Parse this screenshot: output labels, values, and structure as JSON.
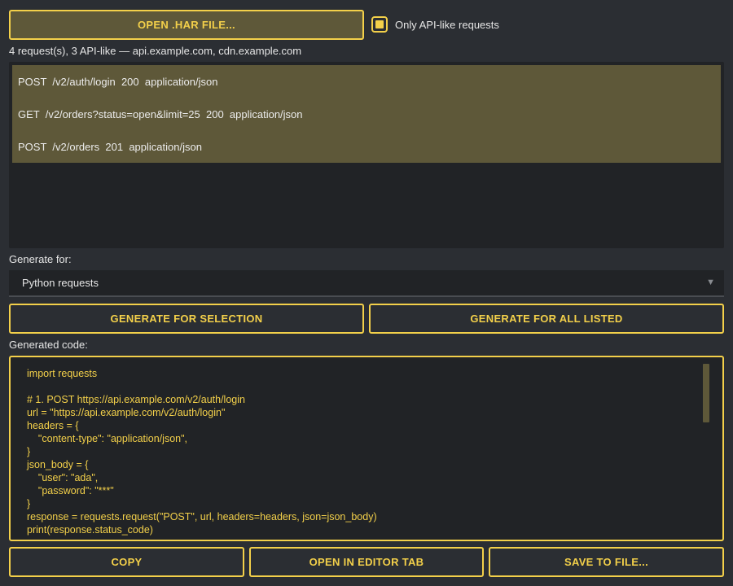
{
  "toolbar": {
    "open_har_label": "OPEN .HAR FILE...",
    "filter_label": "Only API-like requests",
    "filter_checked": true
  },
  "summary": "4 request(s), 3 API-like — api.example.com, cdn.example.com",
  "requests": [
    {
      "text": "POST  /v2/auth/login  200  application/json"
    },
    {
      "text": "GET  /v2/orders?status=open&limit=25  200  application/json"
    },
    {
      "text": "POST  /v2/orders  201  application/json"
    }
  ],
  "generate": {
    "label": "Generate for:",
    "selected_target": "Python requests",
    "selection_button": "GENERATE FOR SELECTION",
    "all_button": "GENERATE FOR ALL LISTED"
  },
  "code": {
    "label": "Generated code:",
    "text": "import requests\n\n# 1. POST https://api.example.com/v2/auth/login\nurl = \"https://api.example.com/v2/auth/login\"\nheaders = {\n    \"content-type\": \"application/json\",\n}\njson_body = {\n    \"user\": \"ada\",\n    \"password\": \"***\"\n}\nresponse = requests.request(\"POST\", url, headers=headers, json=json_body)\nprint(response.status_code)"
  },
  "actions": {
    "copy": "COPY",
    "open_editor": "OPEN IN EDITOR TAB",
    "save": "SAVE TO FILE..."
  },
  "colors": {
    "accent": "#f3d04a",
    "selection": "#5e5839",
    "background": "#2b2e33",
    "panel": "#212326"
  },
  "icons": {
    "dropdown": "chevron-down-icon"
  }
}
